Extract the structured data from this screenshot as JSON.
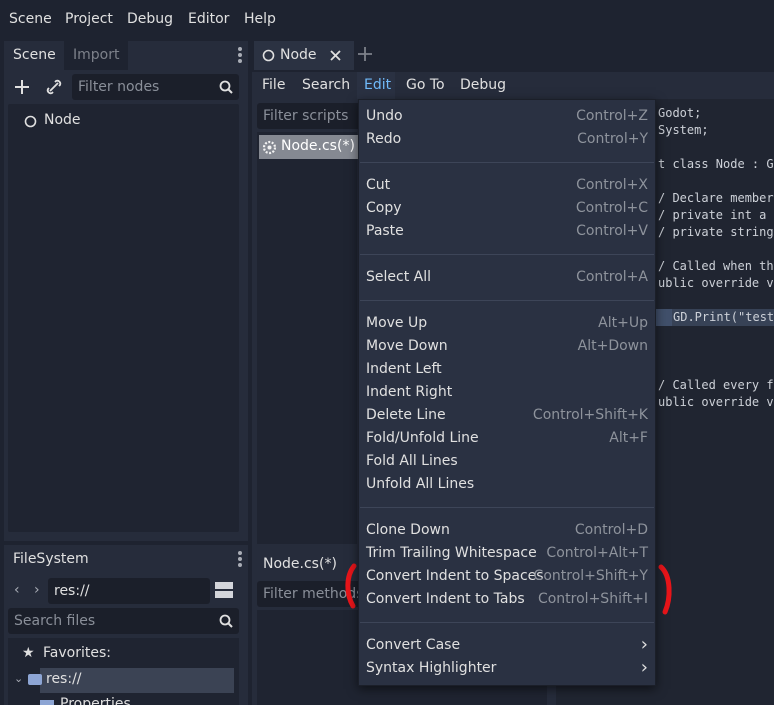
{
  "top_menu": [
    "Scene",
    "Project",
    "Debug",
    "Editor",
    "Help"
  ],
  "scene_dock": {
    "tabs": [
      "Scene",
      "Import"
    ],
    "filter_placeholder": "Filter nodes",
    "tree_root": "Node"
  },
  "filesystem_dock": {
    "tab": "FileSystem",
    "path": "res://",
    "search_placeholder": "Search files",
    "favorites": "Favorites:",
    "root": "res://",
    "child_partial": "Properties"
  },
  "editor_tab": {
    "title": "Node"
  },
  "script_menu": [
    "File",
    "Search",
    "Edit",
    "Go To",
    "Debug"
  ],
  "script_list": {
    "filter_placeholder": "Filter scripts",
    "item": "Node.cs(*)",
    "current_label": "Node.cs(*)",
    "methods_placeholder": "Filter methods"
  },
  "code_lines": [
    "Godot;",
    "System;",
    "t class Node : God",
    "/ Declare member v",
    "/ private int a =",
    "/ private string b",
    "/ Called when the",
    "ublic override vo",
    "GD.Print(\"test\"",
    "/ Called every fra",
    "ublic override vo"
  ],
  "edit_menu": {
    "groups": [
      [
        {
          "label": "Undo",
          "shortcut": "Control+Z"
        },
        {
          "label": "Redo",
          "shortcut": "Control+Y"
        }
      ],
      [
        {
          "label": "Cut",
          "shortcut": "Control+X"
        },
        {
          "label": "Copy",
          "shortcut": "Control+C"
        },
        {
          "label": "Paste",
          "shortcut": "Control+V"
        }
      ],
      [
        {
          "label": "Select All",
          "shortcut": "Control+A"
        }
      ],
      [
        {
          "label": "Move Up",
          "shortcut": "Alt+Up"
        },
        {
          "label": "Move Down",
          "shortcut": "Alt+Down"
        },
        {
          "label": "Indent Left",
          "shortcut": ""
        },
        {
          "label": "Indent Right",
          "shortcut": ""
        },
        {
          "label": "Delete Line",
          "shortcut": "Control+Shift+K"
        },
        {
          "label": "Fold/Unfold Line",
          "shortcut": "Alt+F"
        },
        {
          "label": "Fold All Lines",
          "shortcut": ""
        },
        {
          "label": "Unfold All Lines",
          "shortcut": ""
        }
      ],
      [
        {
          "label": "Clone Down",
          "shortcut": "Control+D"
        },
        {
          "label": "Trim Trailing Whitespace",
          "shortcut": "Control+Alt+T"
        },
        {
          "label": "Convert Indent to Spaces",
          "shortcut": "Control+Shift+Y"
        },
        {
          "label": "Convert Indent to Tabs",
          "shortcut": "Control+Shift+I"
        }
      ],
      [
        {
          "label": "Convert Case",
          "shortcut": "",
          "submenu": true
        },
        {
          "label": "Syntax Highlighter",
          "shortcut": "",
          "submenu": true
        }
      ]
    ]
  },
  "colors": {
    "accent": "#70bafa",
    "annotation": "#e8151a",
    "menu_bg": "#2a3142"
  }
}
